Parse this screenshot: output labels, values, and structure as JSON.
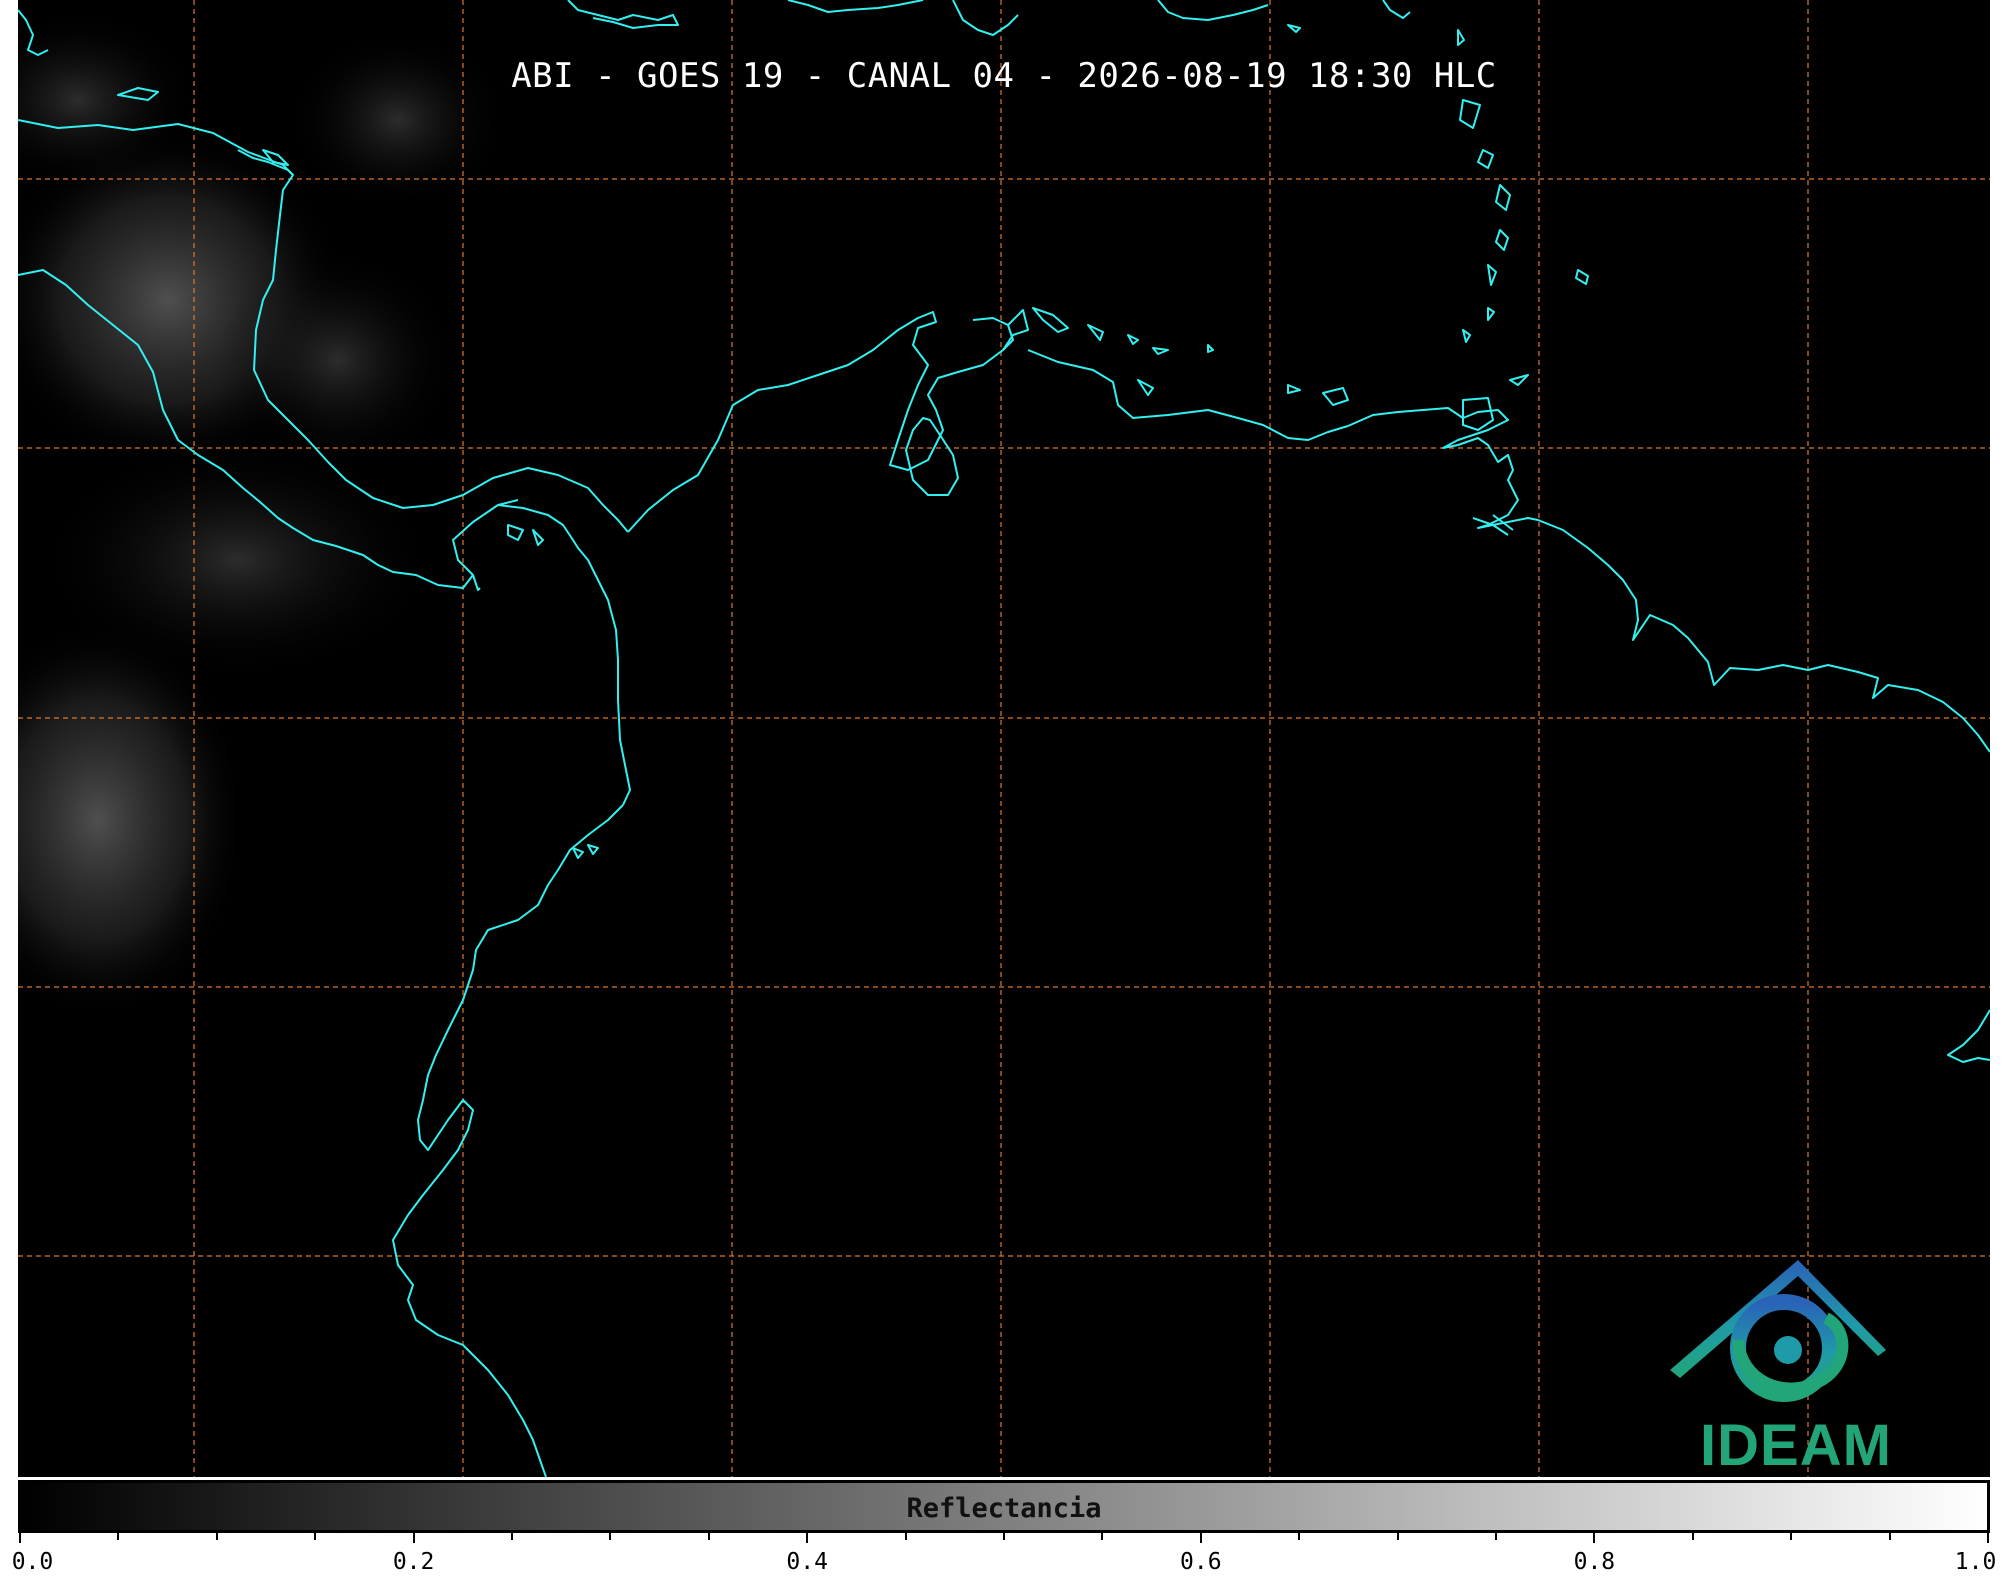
{
  "map": {
    "title": "ABI - GOES 19 - CANAL 04 - 2026-08-19 18:30 HLC",
    "background_color": "#000000",
    "coastline_color": "#33f0f0",
    "grid_color": "#e07828",
    "grid_style": "dashed"
  },
  "logo": {
    "text": "IDEAM",
    "text_color": "#22a578",
    "icon": "ideam-roof-swirl-logo"
  },
  "colorbar": {
    "label": "Reflectancia",
    "range": [
      0.0,
      1.0
    ],
    "gradient": [
      "#000000",
      "#ffffff"
    ],
    "major_ticks": [
      "0.0",
      "0.2",
      "0.4",
      "0.6",
      "0.8",
      "1.0"
    ],
    "minor_tick_step": 0.05
  }
}
